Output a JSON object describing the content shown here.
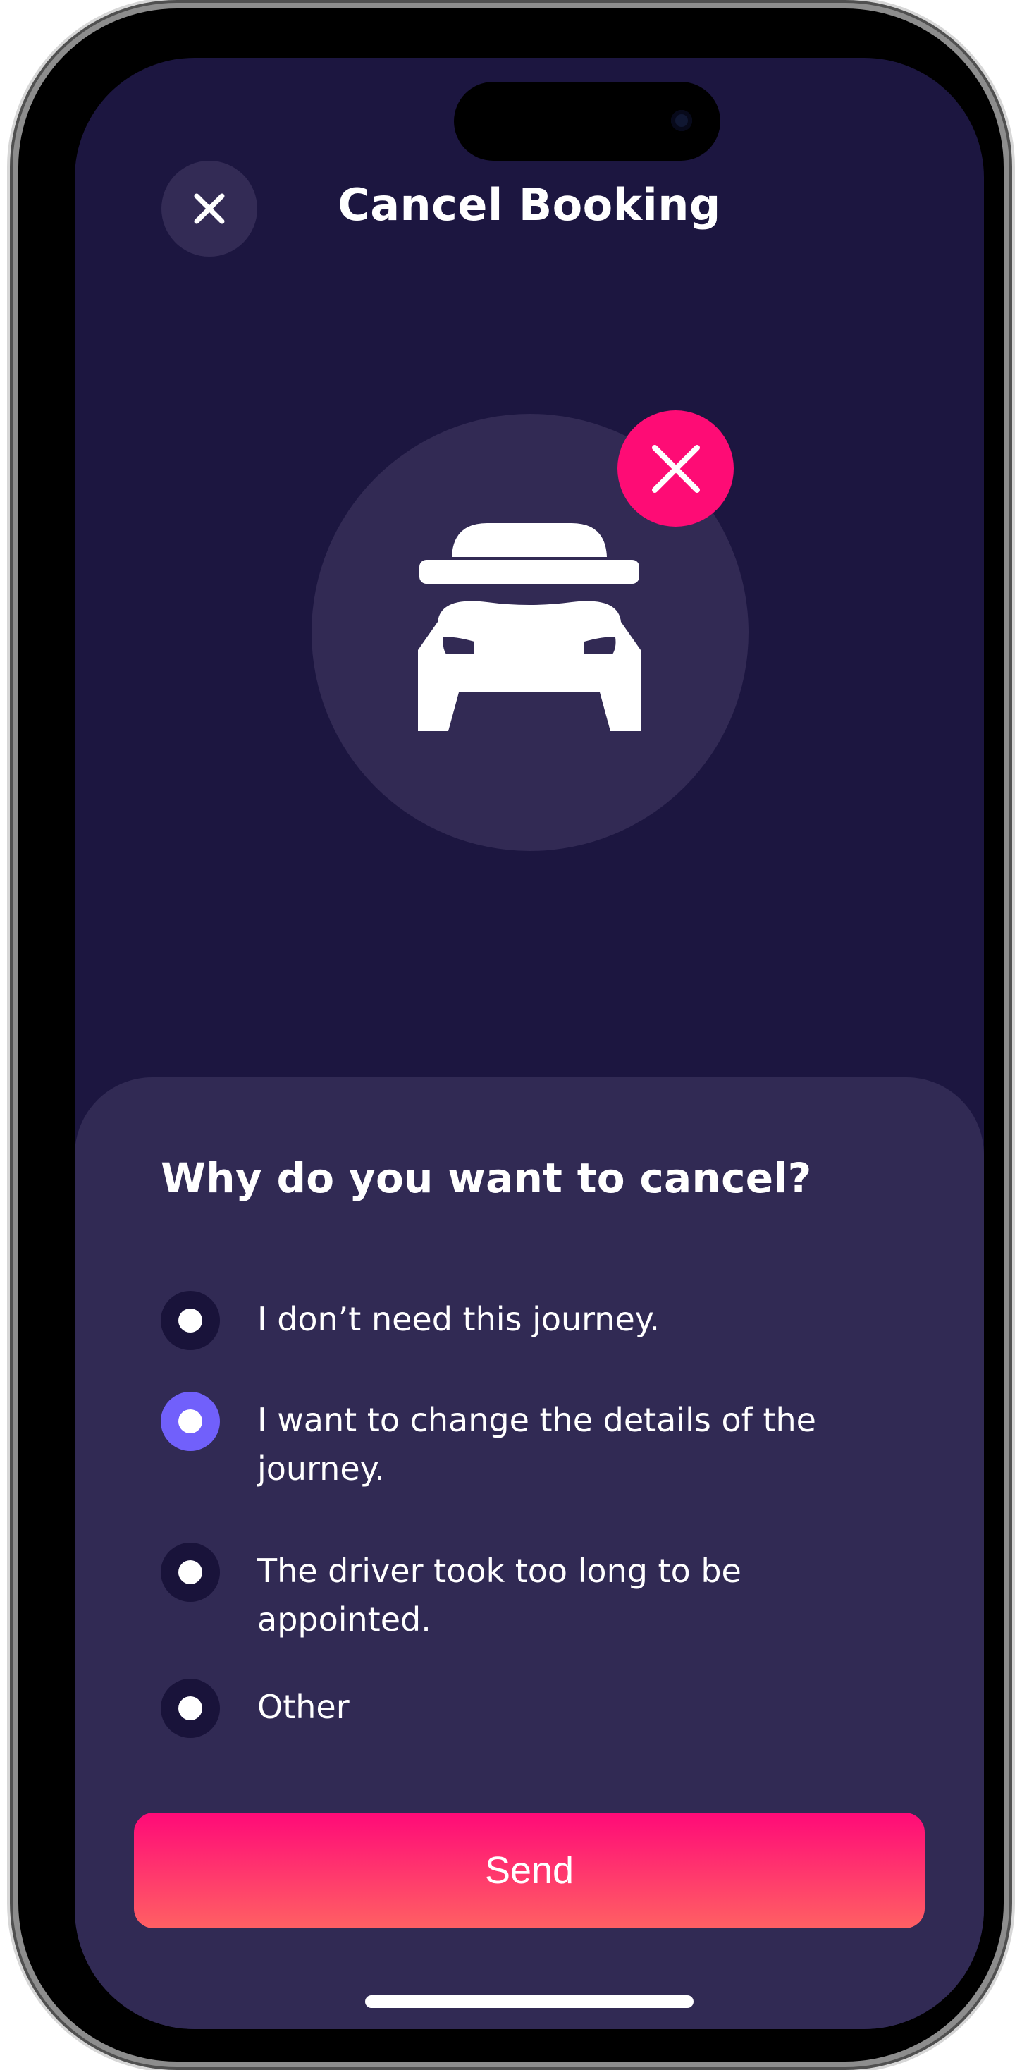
{
  "header": {
    "title": "Cancel Booking",
    "close_icon": "close-icon"
  },
  "hero": {
    "icon": "car-front-icon",
    "badge_icon": "x-icon",
    "badge_color": "#fe0c75"
  },
  "sheet": {
    "question": "Why do you want to cancel?",
    "options": [
      {
        "label": "I don’t need this journey.",
        "selected": false
      },
      {
        "label": "I want to change the details of the journey.",
        "selected": true
      },
      {
        "label": "The driver took too long to be appointed.",
        "selected": false
      },
      {
        "label": "Other",
        "selected": false
      }
    ]
  },
  "send_button": {
    "label": "Send"
  },
  "colors": {
    "background": "#1c1640",
    "surface": "#312a54",
    "accent": "#7160fb",
    "button_gradient_top": "#ff0a78",
    "button_gradient_bottom": "#ff6063"
  }
}
